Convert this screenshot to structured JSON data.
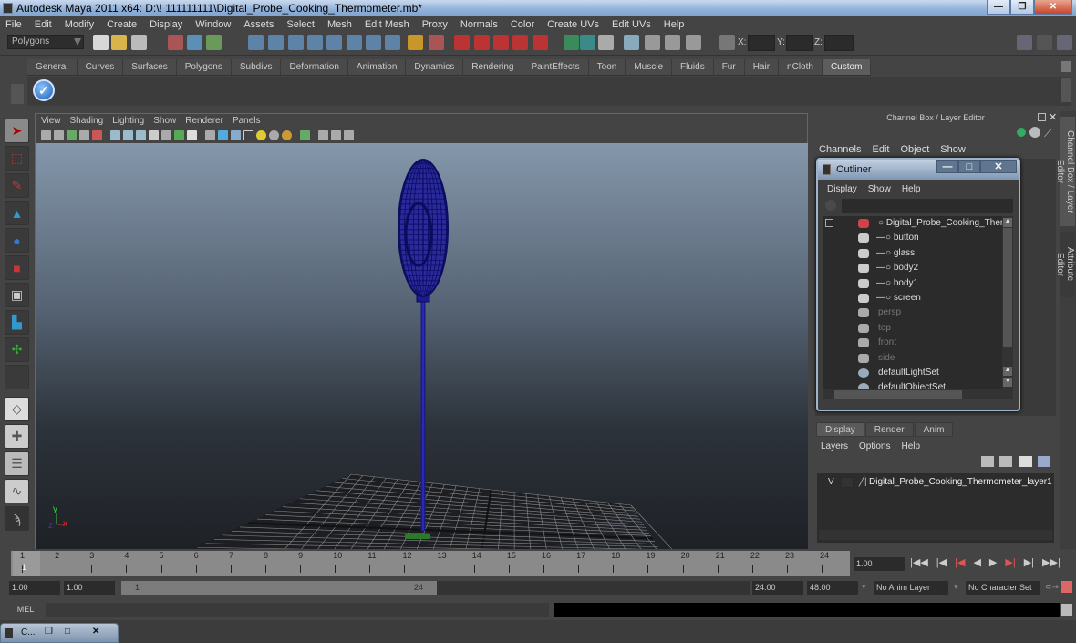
{
  "window": {
    "title": "Autodesk Maya 2011 x64: D:\\! 111111111\\Digital_Probe_Cooking_Thermometer.mb*",
    "buttons": {
      "minimize": "—",
      "restore": "❐",
      "close": "✕"
    }
  },
  "menubar": [
    "File",
    "Edit",
    "Modify",
    "Create",
    "Display",
    "Window",
    "Assets",
    "Select",
    "Mesh",
    "Edit Mesh",
    "Proxy",
    "Normals",
    "Color",
    "Create UVs",
    "Edit UVs",
    "Help"
  ],
  "statusline": {
    "mode": "Polygons",
    "x_label": "X:",
    "y_label": "Y:",
    "z_label": "Z:",
    "x_value": "",
    "y_value": "",
    "z_value": ""
  },
  "shelf": {
    "tabs": [
      "General",
      "Curves",
      "Surfaces",
      "Polygons",
      "Subdivs",
      "Deformation",
      "Animation",
      "Dynamics",
      "Rendering",
      "PaintEffects",
      "Toon",
      "Muscle",
      "Fluids",
      "Fur",
      "Hair",
      "nCloth",
      "Custom"
    ],
    "active_tab": "Custom",
    "items": [
      "check-icon"
    ]
  },
  "toolbox": {
    "tools": [
      "select-tool",
      "lasso-tool",
      "paint-select-tool",
      "move-tool-soft",
      "rotate-tool",
      "scale-tool",
      "universal-manipulator",
      "soft-modification-tool",
      "show-manipulator",
      "empty-slot"
    ],
    "layouts": [
      "single-perspective-layout",
      "four-view-layout",
      "outliner-persp-layout",
      "graph-editor-layout",
      "maya-logo"
    ]
  },
  "viewport": {
    "menu": [
      "View",
      "Shading",
      "Lighting",
      "Show",
      "Renderer",
      "Panels"
    ],
    "axis": {
      "x": "x",
      "y": "y",
      "z": "z"
    }
  },
  "channelbox": {
    "title": "Channel Box / Layer Editor",
    "menu": [
      "Channels",
      "Edit",
      "Object",
      "Show"
    ]
  },
  "sidetabs": [
    "Channel Box / Layer Editor",
    "Attribute Editor"
  ],
  "outliner": {
    "title": "Outliner",
    "menu": [
      "Display",
      "Show",
      "Help"
    ],
    "filter": "",
    "items": [
      {
        "label": "Digital_Probe_Cooking_Thermome",
        "type": "group",
        "dim": false,
        "level": 0
      },
      {
        "label": "button",
        "type": "mesh",
        "dim": false,
        "level": 1
      },
      {
        "label": "glass",
        "type": "mesh",
        "dim": false,
        "level": 1
      },
      {
        "label": "body2",
        "type": "mesh",
        "dim": false,
        "level": 1
      },
      {
        "label": "body1",
        "type": "mesh",
        "dim": false,
        "level": 1
      },
      {
        "label": "screen",
        "type": "mesh",
        "dim": false,
        "level": 1
      },
      {
        "label": "persp",
        "type": "camera",
        "dim": true,
        "level": 0
      },
      {
        "label": "top",
        "type": "camera",
        "dim": true,
        "level": 0
      },
      {
        "label": "front",
        "type": "camera",
        "dim": true,
        "level": 0
      },
      {
        "label": "side",
        "type": "camera",
        "dim": true,
        "level": 0
      },
      {
        "label": "defaultLightSet",
        "type": "set",
        "dim": false,
        "level": 0
      },
      {
        "label": "defaultObjectSet",
        "type": "set",
        "dim": false,
        "level": 0
      }
    ]
  },
  "layer_editor": {
    "tabs": [
      "Display",
      "Render",
      "Anim"
    ],
    "active_tab": "Display",
    "menu": [
      "Layers",
      "Options",
      "Help"
    ],
    "layers": [
      {
        "visible": "V",
        "name": "Digital_Probe_Cooking_Thermometer_layer1"
      }
    ]
  },
  "timeline": {
    "ticks": [
      "1",
      "2",
      "3",
      "4",
      "5",
      "6",
      "7",
      "8",
      "9",
      "10",
      "11",
      "12",
      "13",
      "14",
      "15",
      "16",
      "17",
      "18",
      "19",
      "20",
      "21",
      "22",
      "23",
      "24"
    ],
    "current_frame_marker": "1",
    "current_frame": "1.00",
    "playback": [
      "go-to-start",
      "step-back-key",
      "step-back-frame",
      "play-backward",
      "play-forward",
      "step-forward-frame",
      "step-forward-key",
      "go-to-end"
    ]
  },
  "range": {
    "start": "1.00",
    "playback_start": "1.00",
    "slider_start": "1",
    "slider_end": "24",
    "playback_end": "24.00",
    "end": "48.00",
    "anim_layer": "No Anim Layer",
    "character_set": "No Character Set"
  },
  "cmdline": {
    "label": "MEL",
    "input": "",
    "output": ""
  },
  "minimized_window": {
    "label": "C..."
  }
}
